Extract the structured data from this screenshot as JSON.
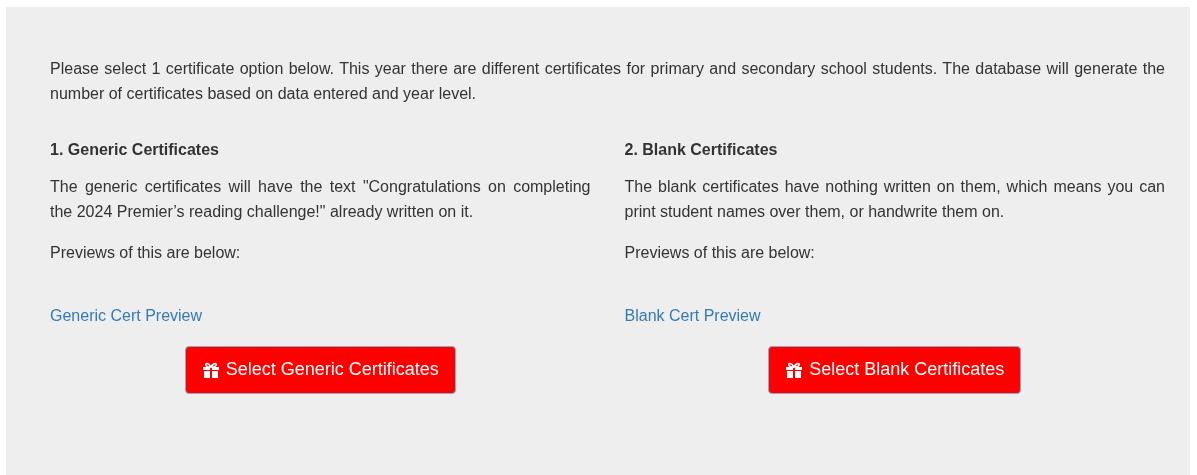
{
  "intro": "Please select 1 certificate option below. This year there are different certificates for primary and secondary school students. The database will generate the number of certificates based on data entered and year level.",
  "options": [
    {
      "heading": "1. Generic Certificates",
      "description": "The generic certificates will have the text \"Congratulations on completing the 2024 Premier’s reading challenge!\" already written on it.",
      "previews": "Previews of this are below:",
      "link": "Generic Cert Preview",
      "button": "Select Generic Certificates"
    },
    {
      "heading": "2. Blank Certificates",
      "description": "The blank certificates have nothing written on them, which means you can print student names over them, or handwrite them on.",
      "previews": "Previews of this are below:",
      "link": "Blank Cert Preview",
      "button": "Select Blank Certificates"
    }
  ]
}
